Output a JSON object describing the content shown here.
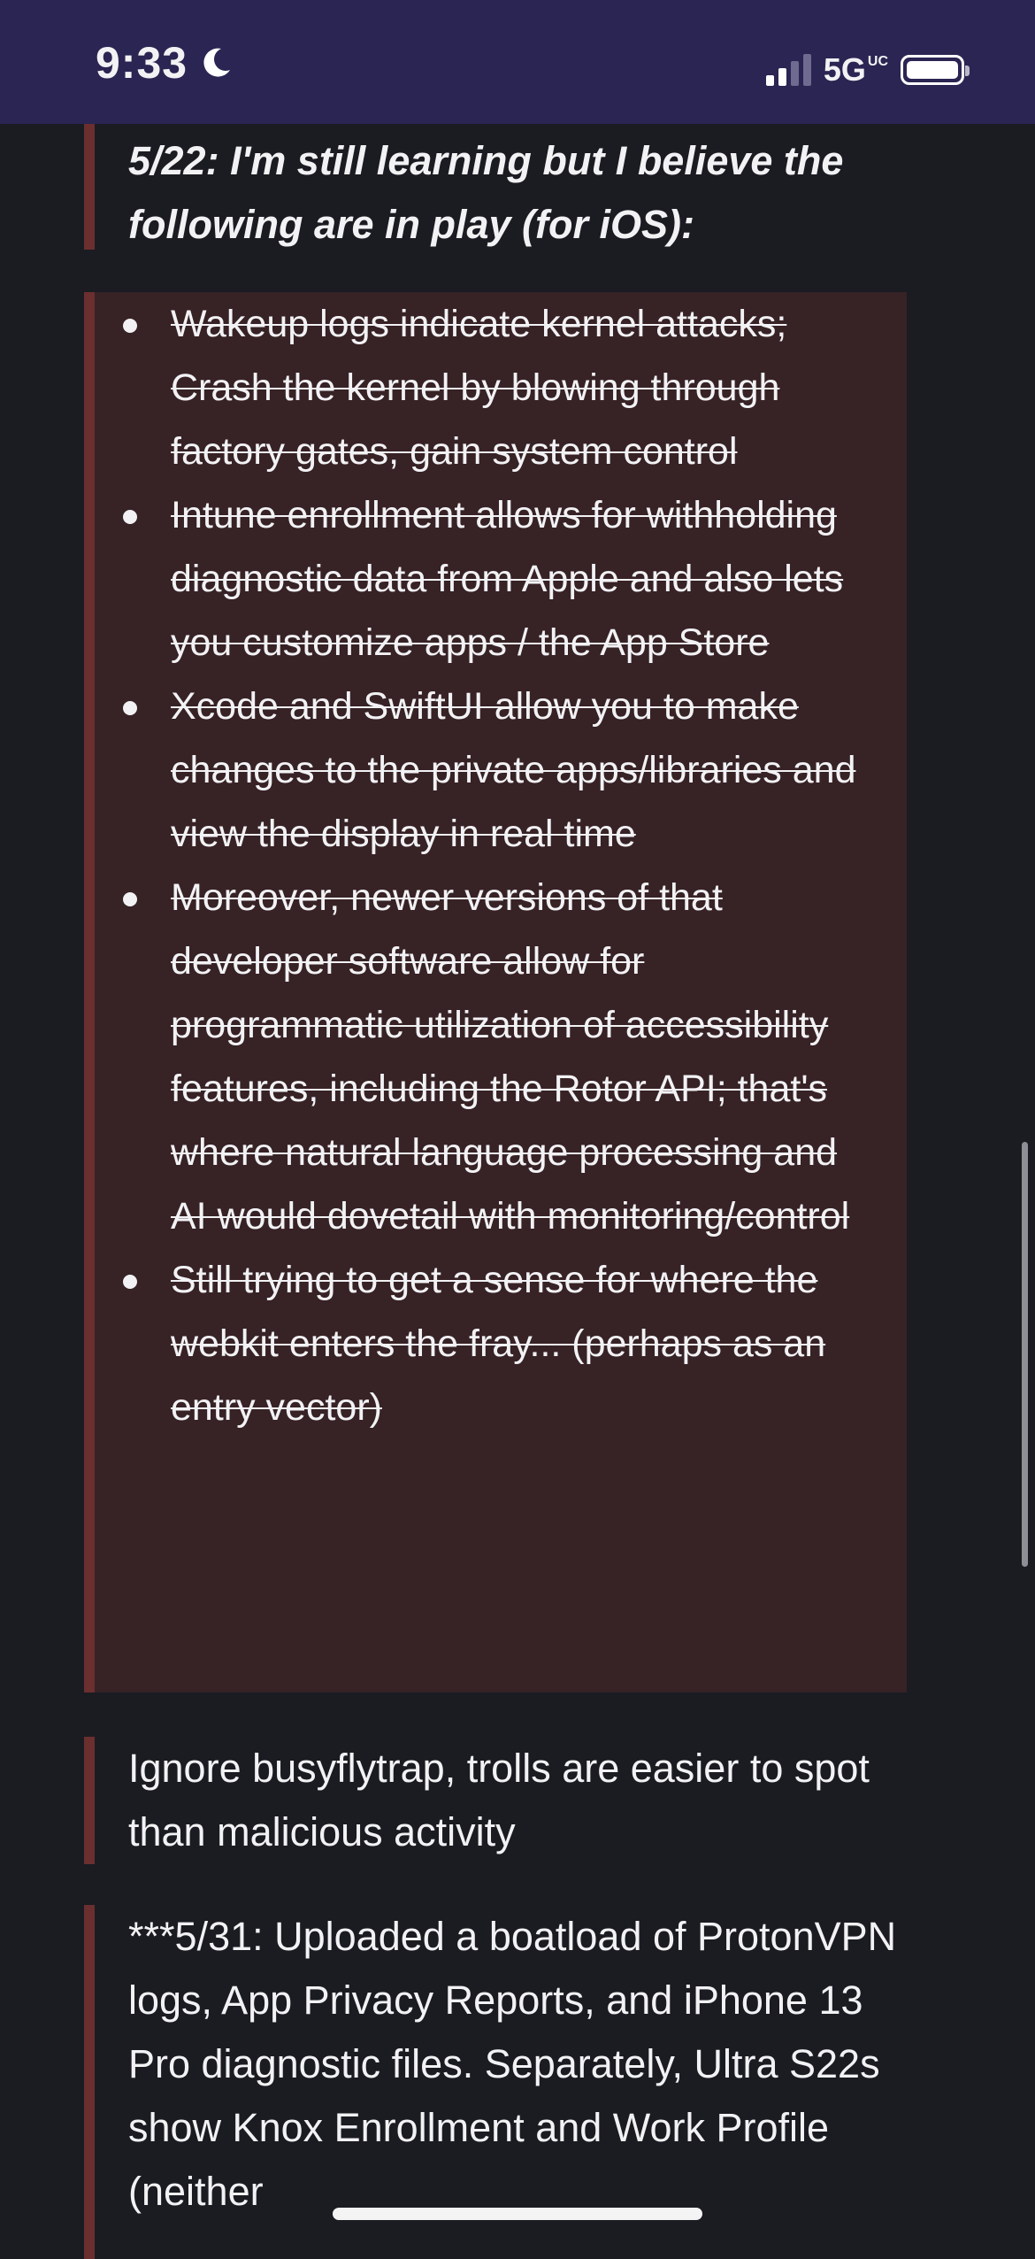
{
  "status_bar": {
    "time": "9:33",
    "network": "5G",
    "network_suffix": "UC",
    "icons": [
      "moon-icon",
      "signal-icon",
      "battery-icon"
    ]
  },
  "post": {
    "header": "5/22: I'm still learning but I believe the following are in play (for iOS):",
    "items": [
      "Wakeup logs indicate kernel attacks; Crash the kernel by blowing through factory gates, gain system control",
      "Intune enrollment allows for withholding diagnostic data from Apple and also lets you customize apps / the App Store",
      "Xcode and SwiftUI allow you to make changes to the private apps/libraries and view the display in real time",
      "Moreover, newer versions of that developer software allow for programmatic utilization of accessibility features, including the Rotor API; that's where natural language processing and AI would dovetail with monitoring/control",
      "Still trying to get a sense for where the webkit enters the fray... (perhaps as an entry vector)"
    ],
    "ignore_note": "Ignore busyflytrap, trolls are easier to spot than malicious activity",
    "upload_note": "***5/31: Uploaded a boatload of ProtonVPN logs, App Privacy Reports, and iPhone 13 Pro diagnostic files. Separately, Ultra S22s show Knox Enrollment and Work Profile (neither"
  },
  "colors": {
    "status_bar_bg": "#2a2552",
    "page_bg": "#1a1c22",
    "quote_border": "#6b2f2f",
    "quote_list_bg": "#372226",
    "text": "#f2f2f4"
  }
}
